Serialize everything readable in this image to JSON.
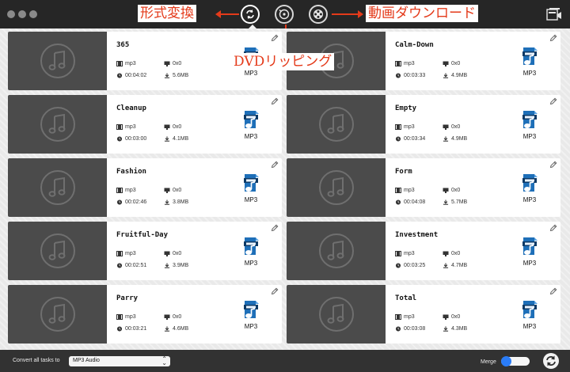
{
  "annotations": {
    "convert": "形式変換",
    "download": "動画ダウンロード",
    "dvd": "DVDリッピング"
  },
  "toolbar": {
    "modes": [
      "convert-mode",
      "dvd-mode",
      "download-mode"
    ],
    "active_mode": "convert-mode"
  },
  "colors": {
    "annotation": "#e43a1a",
    "thumb": "#4b4b4b",
    "toggle_on": "#2a7cf7"
  },
  "tasks": [
    {
      "title": "365",
      "format": "mp3",
      "resolution": "0x0",
      "duration": "00:04:02",
      "size": "5.6MB",
      "target": "MP3"
    },
    {
      "title": "Calm-Down",
      "format": "mp3",
      "resolution": "0x0",
      "duration": "00:03:33",
      "size": "4.9MB",
      "target": "MP3"
    },
    {
      "title": "Cleanup",
      "format": "mp3",
      "resolution": "0x0",
      "duration": "00:03:00",
      "size": "4.1MB",
      "target": "MP3"
    },
    {
      "title": "Empty",
      "format": "mp3",
      "resolution": "0x0",
      "duration": "00:03:34",
      "size": "4.9MB",
      "target": "MP3"
    },
    {
      "title": "Fashion",
      "format": "mp3",
      "resolution": "0x0",
      "duration": "00:02:46",
      "size": "3.8MB",
      "target": "MP3"
    },
    {
      "title": "Form",
      "format": "mp3",
      "resolution": "0x0",
      "duration": "00:04:08",
      "size": "5.7MB",
      "target": "MP3"
    },
    {
      "title": "Fruitful-Day",
      "format": "mp3",
      "resolution": "0x0",
      "duration": "00:02:51",
      "size": "3.9MB",
      "target": "MP3"
    },
    {
      "title": "Investment",
      "format": "mp3",
      "resolution": "0x0",
      "duration": "00:03:25",
      "size": "4.7MB",
      "target": "MP3"
    },
    {
      "title": "Parry",
      "format": "mp3",
      "resolution": "0x0",
      "duration": "00:03:21",
      "size": "4.6MB",
      "target": "MP3"
    },
    {
      "title": "Total",
      "format": "mp3",
      "resolution": "0x0",
      "duration": "00:03:08",
      "size": "4.3MB",
      "target": "MP3"
    }
  ],
  "footer": {
    "convert_label": "Convert all tasks to",
    "convert_value": "MP3 Audio",
    "merge_label": "Merge",
    "merge_on": true
  }
}
